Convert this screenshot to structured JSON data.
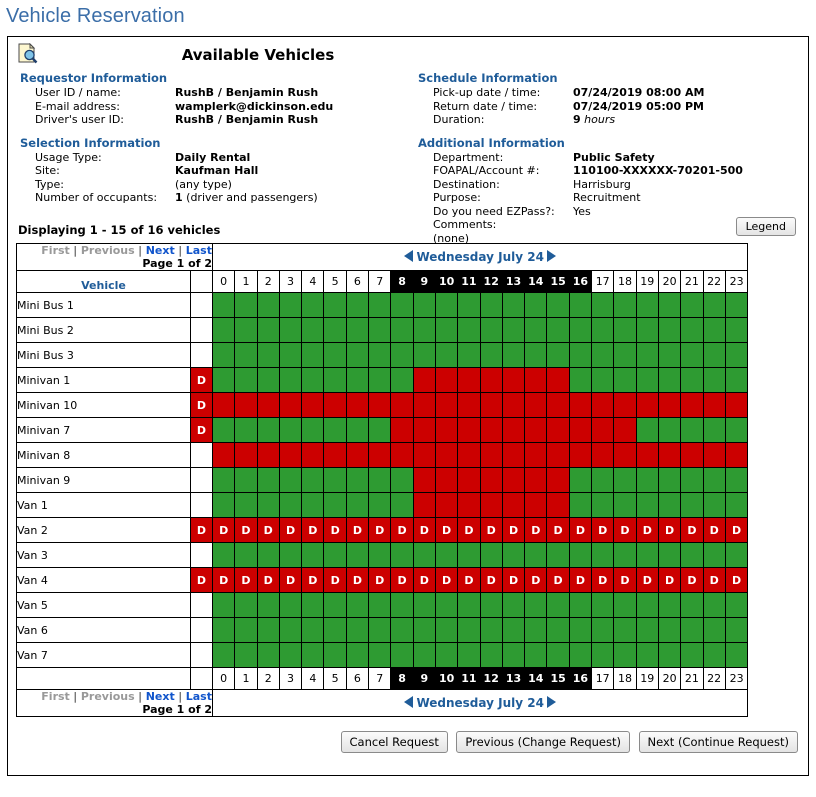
{
  "page": {
    "title": "Vehicle Reservation",
    "title_color": "#3b6ea8"
  },
  "panel": {
    "icon": "document-search-icon",
    "heading": "Available Vehicles"
  },
  "requestor_information": {
    "group_title": "Requestor Information",
    "rows": [
      {
        "label": "User ID / name:",
        "value": "RushB / Benjamin Rush"
      },
      {
        "label": "E-mail address:",
        "value": "wamplerk@dickinson.edu"
      },
      {
        "label": "Driver's user ID:",
        "value": "RushB / Benjamin Rush"
      }
    ]
  },
  "selection_information": {
    "group_title": "Selection Information",
    "rows": [
      {
        "label": "Usage Type:",
        "value": "Daily Rental"
      },
      {
        "label": "Site:",
        "value": "Kaufman Hall"
      },
      {
        "label": "Type:",
        "value": "(any type)"
      },
      {
        "label": "Number of occupants:",
        "value_bold": "1",
        "value": " (driver and passengers)"
      }
    ]
  },
  "schedule_information": {
    "group_title": "Schedule Information",
    "rows": [
      {
        "label": "Pick-up date / time:",
        "value": "07/24/2019 08:00 AM"
      },
      {
        "label": "Return date / time:",
        "value": "07/24/2019 05:00 PM"
      },
      {
        "label": "Duration:",
        "value_bold": "9",
        "value_italic": " hours"
      }
    ]
  },
  "additional_information": {
    "group_title": "Additional Information",
    "rows": [
      {
        "label": "Department:",
        "value": "Public Safety"
      },
      {
        "label": "FOAPAL/Account #:",
        "value": "110100-XXXXXX-70201-500"
      },
      {
        "label": "Destination:",
        "value": "Harrisburg"
      },
      {
        "label": "Purpose:",
        "value": "Recruitment"
      },
      {
        "label": "Do you need EZPass?:",
        "value": "Yes"
      },
      {
        "label": "Comments:",
        "value": ""
      },
      {
        "label": "(none)",
        "value": ""
      }
    ]
  },
  "results": {
    "displaying": "Displaying 1 - 15 of 16 vehicles",
    "legend_button": "Legend"
  },
  "pager": {
    "first": "First",
    "previous": "Previous",
    "next": "Next",
    "last": "Last",
    "separator": "|",
    "page_of": "Page 1 of 2"
  },
  "day_nav": {
    "label": "Wednesday July 24",
    "prev_icon": "left-arrow-icon",
    "next_icon": "right-arrow-icon"
  },
  "grid": {
    "vehicle_header": "Vehicle",
    "d_marker": "D",
    "hours": [
      "0",
      "1",
      "2",
      "3",
      "4",
      "5",
      "6",
      "7",
      "8",
      "9",
      "10",
      "11",
      "12",
      "13",
      "14",
      "15",
      "16",
      "17",
      "18",
      "19",
      "20",
      "21",
      "22",
      "23"
    ],
    "selected_hours": [
      "8",
      "9",
      "10",
      "11",
      "12",
      "13",
      "14",
      "15",
      "16"
    ],
    "colors": {
      "available": "#2e9b32",
      "unavailable": "#cc0000",
      "selected_hour_bg": "#000000",
      "link": "#1155cc",
      "heading": "#1f5c99"
    },
    "rows": [
      {
        "vehicle": "Mini Bus 1",
        "d": false,
        "cells": [
          "free",
          "free",
          "free",
          "free",
          "free",
          "free",
          "free",
          "free",
          "free",
          "free",
          "free",
          "free",
          "free",
          "free",
          "free",
          "free",
          "free",
          "free",
          "free",
          "free",
          "free",
          "free",
          "free",
          "free"
        ]
      },
      {
        "vehicle": "Mini Bus 2",
        "d": false,
        "cells": [
          "free",
          "free",
          "free",
          "free",
          "free",
          "free",
          "free",
          "free",
          "free",
          "free",
          "free",
          "free",
          "free",
          "free",
          "free",
          "free",
          "free",
          "free",
          "free",
          "free",
          "free",
          "free",
          "free",
          "free"
        ]
      },
      {
        "vehicle": "Mini Bus 3",
        "d": false,
        "cells": [
          "free",
          "free",
          "free",
          "free",
          "free",
          "free",
          "free",
          "free",
          "free",
          "free",
          "free",
          "free",
          "free",
          "free",
          "free",
          "free",
          "free",
          "free",
          "free",
          "free",
          "free",
          "free",
          "free",
          "free"
        ]
      },
      {
        "vehicle": "Minivan 1",
        "d": true,
        "cells": [
          "free",
          "free",
          "free",
          "free",
          "free",
          "free",
          "free",
          "free",
          "free",
          "busy",
          "busy",
          "busy",
          "busy",
          "busy",
          "busy",
          "busy",
          "free",
          "free",
          "free",
          "free",
          "free",
          "free",
          "free",
          "free"
        ]
      },
      {
        "vehicle": "Minivan 10",
        "d": true,
        "cells": [
          "busy",
          "busy",
          "busy",
          "busy",
          "busy",
          "busy",
          "busy",
          "busy",
          "busy",
          "busy",
          "busy",
          "busy",
          "busy",
          "busy",
          "busy",
          "busy",
          "busy",
          "busy",
          "busy",
          "busy",
          "busy",
          "busy",
          "busy",
          "busy"
        ]
      },
      {
        "vehicle": "Minivan 7",
        "d": true,
        "cells": [
          "free",
          "free",
          "free",
          "free",
          "free",
          "free",
          "free",
          "free",
          "busy",
          "busy",
          "busy",
          "busy",
          "busy",
          "busy",
          "busy",
          "busy",
          "busy",
          "busy",
          "busy",
          "free",
          "free",
          "free",
          "free",
          "free"
        ]
      },
      {
        "vehicle": "Minivan 8",
        "d": false,
        "cells": [
          "busy",
          "busy",
          "busy",
          "busy",
          "busy",
          "busy",
          "busy",
          "busy",
          "busy",
          "busy",
          "busy",
          "busy",
          "busy",
          "busy",
          "busy",
          "busy",
          "busy",
          "busy",
          "busy",
          "busy",
          "busy",
          "busy",
          "busy",
          "busy"
        ]
      },
      {
        "vehicle": "Minivan 9",
        "d": false,
        "cells": [
          "free",
          "free",
          "free",
          "free",
          "free",
          "free",
          "free",
          "free",
          "free",
          "busy",
          "busy",
          "busy",
          "busy",
          "busy",
          "busy",
          "busy",
          "free",
          "free",
          "free",
          "free",
          "free",
          "free",
          "free",
          "free"
        ]
      },
      {
        "vehicle": "Van 1",
        "d": false,
        "cells": [
          "free",
          "free",
          "free",
          "free",
          "free",
          "free",
          "free",
          "free",
          "free",
          "busy",
          "busy",
          "busy",
          "busy",
          "busy",
          "busy",
          "busy",
          "free",
          "free",
          "free",
          "free",
          "free",
          "free",
          "free",
          "free"
        ]
      },
      {
        "vehicle": "Van 2",
        "d": true,
        "cells": [
          "d",
          "d",
          "d",
          "d",
          "d",
          "d",
          "d",
          "d",
          "d",
          "d",
          "d",
          "d",
          "d",
          "d",
          "d",
          "d",
          "d",
          "d",
          "d",
          "d",
          "d",
          "d",
          "d",
          "d"
        ]
      },
      {
        "vehicle": "Van 3",
        "d": false,
        "cells": [
          "free",
          "free",
          "free",
          "free",
          "free",
          "free",
          "free",
          "free",
          "free",
          "free",
          "free",
          "free",
          "free",
          "free",
          "free",
          "free",
          "free",
          "free",
          "free",
          "free",
          "free",
          "free",
          "free",
          "free"
        ]
      },
      {
        "vehicle": "Van 4",
        "d": true,
        "cells": [
          "d",
          "d",
          "d",
          "d",
          "d",
          "d",
          "d",
          "d",
          "d",
          "d",
          "d",
          "d",
          "d",
          "d",
          "d",
          "d",
          "d",
          "d",
          "d",
          "d",
          "d",
          "d",
          "d",
          "d"
        ]
      },
      {
        "vehicle": "Van 5",
        "d": false,
        "cells": [
          "free",
          "free",
          "free",
          "free",
          "free",
          "free",
          "free",
          "free",
          "free",
          "free",
          "free",
          "free",
          "free",
          "free",
          "free",
          "free",
          "free",
          "free",
          "free",
          "free",
          "free",
          "free",
          "free",
          "free"
        ]
      },
      {
        "vehicle": "Van 6",
        "d": false,
        "cells": [
          "free",
          "free",
          "free",
          "free",
          "free",
          "free",
          "free",
          "free",
          "free",
          "free",
          "free",
          "free",
          "free",
          "free",
          "free",
          "free",
          "free",
          "free",
          "free",
          "free",
          "free",
          "free",
          "free",
          "free"
        ]
      },
      {
        "vehicle": "Van 7",
        "d": false,
        "cells": [
          "free",
          "free",
          "free",
          "free",
          "free",
          "free",
          "free",
          "free",
          "free",
          "free",
          "free",
          "free",
          "free",
          "free",
          "free",
          "free",
          "free",
          "free",
          "free",
          "free",
          "free",
          "free",
          "free",
          "free"
        ]
      }
    ]
  },
  "footer_buttons": {
    "cancel": "Cancel Request",
    "previous": "Previous (Change Request)",
    "next": "Next (Continue Request)"
  }
}
